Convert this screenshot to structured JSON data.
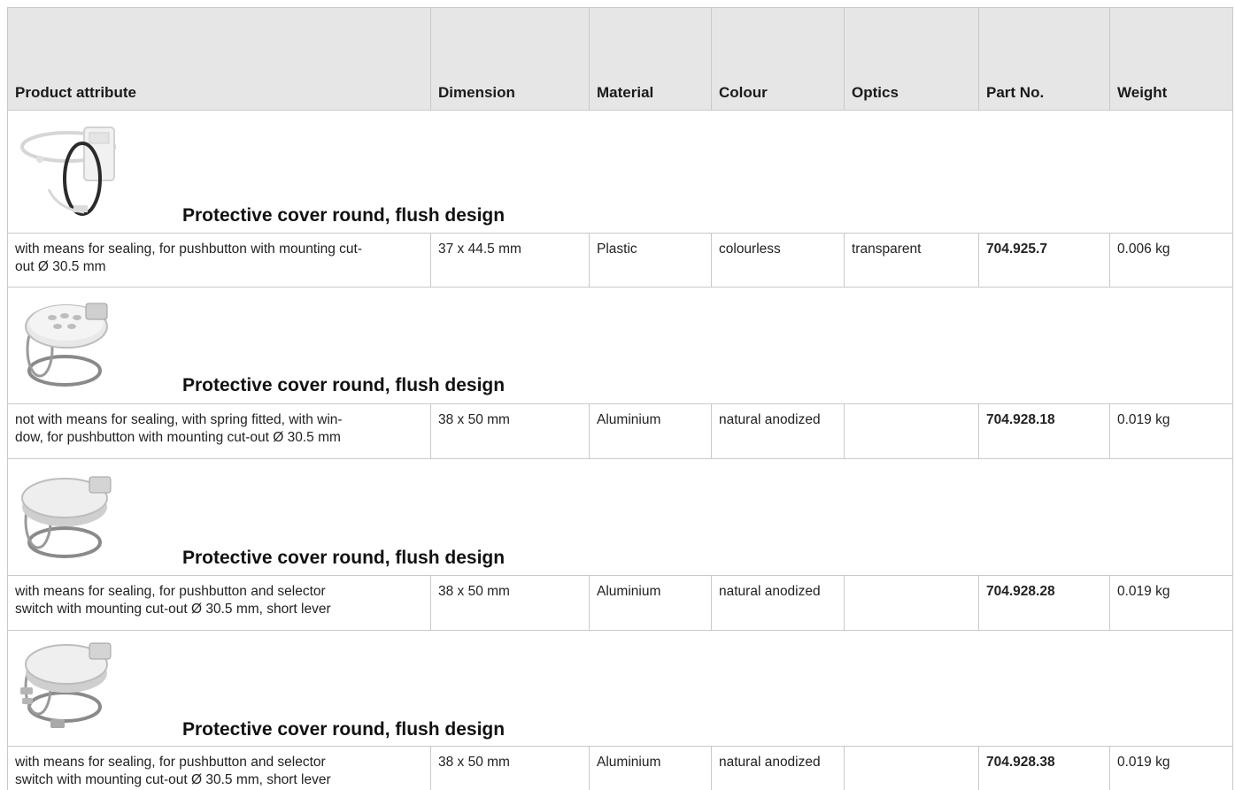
{
  "header": {
    "product_attribute": "Product attribute",
    "dimension": "Dimension",
    "material": "Material",
    "colour": "Colour",
    "optics": "Optics",
    "part_no": "Part No.",
    "weight": "Weight"
  },
  "products": [
    {
      "title": "Protective cover round, flush design",
      "image_icon": "transparent-cover-icon",
      "attribute": "with means for sealing, for pushbutton with mounting cut-out Ø 30.5 mm",
      "attribute_line1": "with means for sealing, for pushbutton with mounting cut-",
      "attribute_line2": "out Ø 30.5 mm",
      "dimension": "37 x 44.5 mm",
      "material": "Plastic",
      "colour": "colourless",
      "optics": "transparent",
      "part_no": "704.925.7",
      "weight": "0.006 kg"
    },
    {
      "title": "Protective cover round, flush design",
      "image_icon": "windowed-cover-icon",
      "attribute_line1": "not with means for sealing, with spring fitted, with win-",
      "attribute_line2": "dow, for pushbutton with mounting cut-out Ø 30.5 mm",
      "dimension": "38 x 50 mm",
      "material": "Aluminium",
      "colour": "natural anodized",
      "optics": "",
      "part_no": "704.928.18",
      "weight": "0.019 kg"
    },
    {
      "title": "Protective cover round, flush design",
      "image_icon": "solid-cover-icon",
      "attribute_line1": "with means for sealing, for pushbutton and selector",
      "attribute_line2": "switch with mounting cut-out Ø 30.5 mm, short lever",
      "dimension": "38 x 50 mm",
      "material": "Aluminium",
      "colour": "natural anodized",
      "optics": "",
      "part_no": "704.928.28",
      "weight": "0.019 kg"
    },
    {
      "title": "Protective cover round, flush design",
      "image_icon": "lever-cover-icon",
      "attribute_line1": "with means for sealing, for pushbutton and selector",
      "attribute_line2": "switch with mounting cut-out Ø 30.5 mm, short lever",
      "dimension": "38 x 50 mm",
      "material": "Aluminium",
      "colour": "natural anodized",
      "optics": "",
      "part_no": "704.928.38",
      "weight": "0.019 kg"
    }
  ],
  "colors": {
    "header_bg": "#e6e6e6",
    "grid_line": "#c9c9c9",
    "text": "#1a1a1a"
  }
}
